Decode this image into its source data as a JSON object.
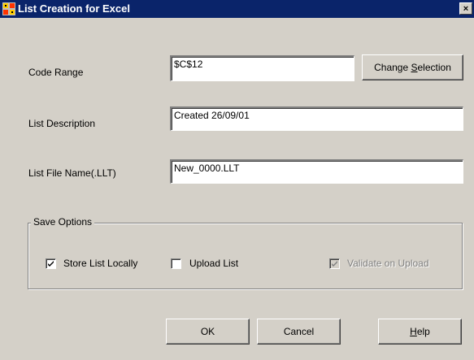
{
  "window": {
    "title": "List Creation for Excel",
    "close_glyph": "×",
    "icon": "excel-list-icon"
  },
  "form": {
    "code_range_label": "Code Range",
    "code_range_value": "$C$12",
    "change_selection_label_pre": "Change ",
    "change_selection_label_accel": "S",
    "change_selection_label_post": "election",
    "list_description_label": "List Description",
    "list_description_value": "Created 26/09/01",
    "list_file_name_label": "List File Name(.LLT)",
    "list_file_name_value": "New_0000.LLT"
  },
  "save_options": {
    "legend": "Save Options",
    "store_locally_label": "Store List Locally",
    "store_locally_checked": true,
    "upload_label": "Upload List",
    "upload_checked": false,
    "validate_label": "Validate on Upload",
    "validate_checked": true,
    "validate_enabled": false
  },
  "buttons": {
    "ok": "OK",
    "cancel": "Cancel",
    "help_accel": "H",
    "help_rest": "elp"
  }
}
